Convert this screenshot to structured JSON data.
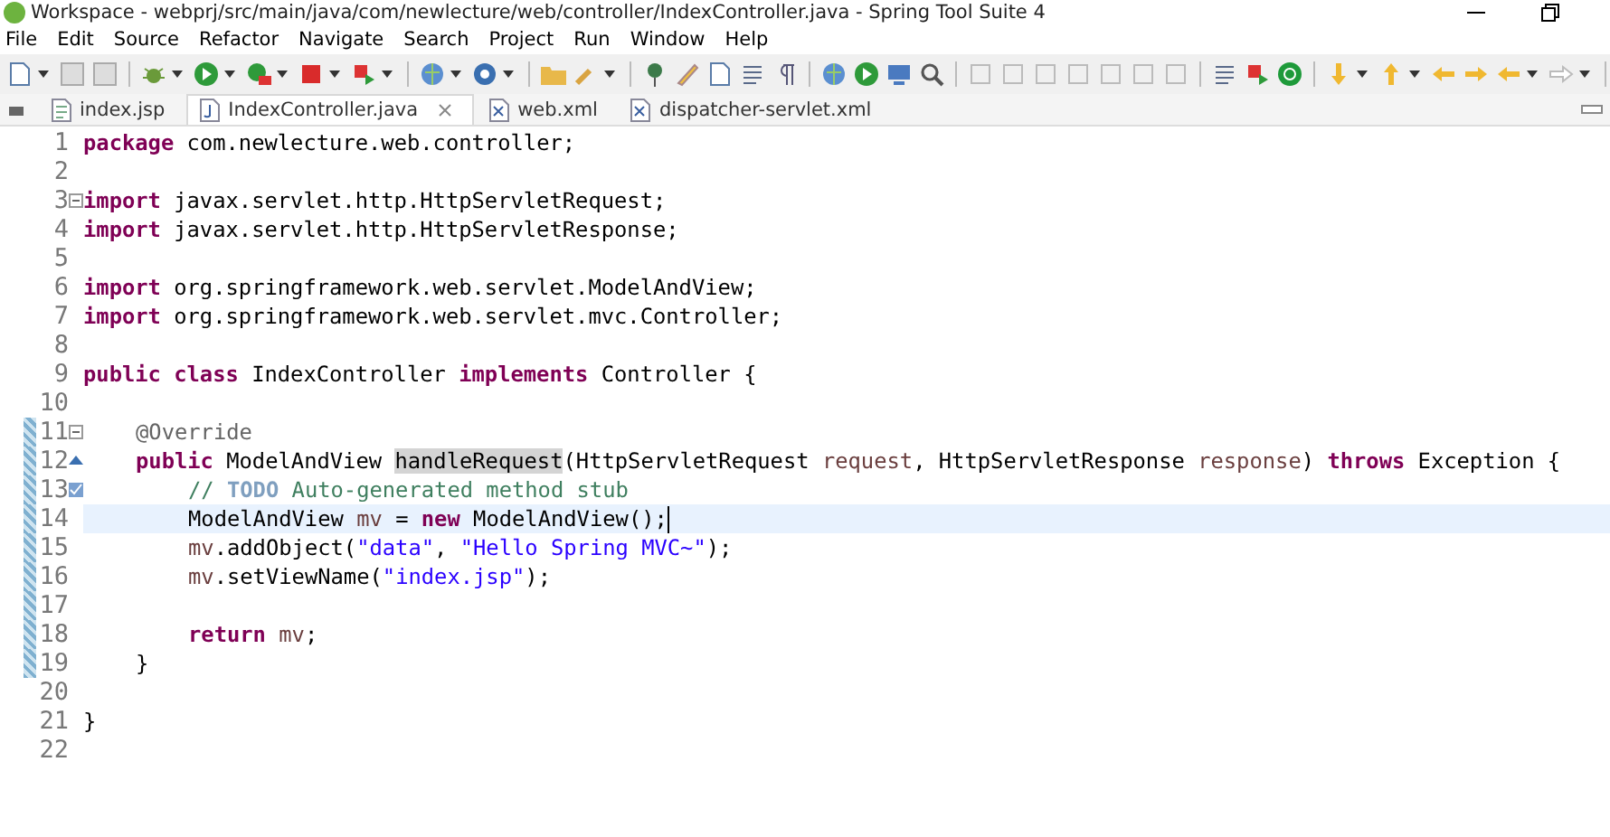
{
  "window": {
    "title": "Workspace - webprj/src/main/java/com/newlecture/web/controller/IndexController.java - Spring Tool Suite 4"
  },
  "menu": [
    "File",
    "Edit",
    "Source",
    "Refactor",
    "Navigate",
    "Search",
    "Project",
    "Run",
    "Window",
    "Help"
  ],
  "tabs": [
    {
      "label": "index.jsp",
      "kind": "jsp",
      "selected": false
    },
    {
      "label": "IndexController.java",
      "kind": "java",
      "selected": true
    },
    {
      "label": "web.xml",
      "kind": "xml",
      "selected": false
    },
    {
      "label": "dispatcher-servlet.xml",
      "kind": "xml",
      "selected": false
    }
  ],
  "editor": {
    "lines": [
      {
        "n": "1",
        "tokens": [
          {
            "t": "package",
            "kind": "kw"
          },
          {
            "t": " com.newlecture.web.controller;",
            "kind": "plain"
          }
        ]
      },
      {
        "n": "2"
      },
      {
        "n": "3",
        "kind": "fold",
        "tokens": [
          {
            "t": "import",
            "kind": "kw"
          },
          {
            "t": " javax.servlet.http.HttpServletRequest;",
            "kind": "plain"
          }
        ]
      },
      {
        "n": "4",
        "tokens": [
          {
            "t": "import",
            "kind": "kw"
          },
          {
            "t": " javax.servlet.http.HttpServletResponse;",
            "kind": "plain"
          }
        ]
      },
      {
        "n": "5"
      },
      {
        "n": "6",
        "tokens": [
          {
            "t": "import",
            "kind": "kw"
          },
          {
            "t": " org.springframework.web.servlet.ModelAndView;",
            "kind": "plain"
          }
        ]
      },
      {
        "n": "7",
        "tokens": [
          {
            "t": "import",
            "kind": "kw"
          },
          {
            "t": " org.springframework.web.servlet.mvc.Controller;",
            "kind": "plain"
          }
        ]
      },
      {
        "n": "8"
      },
      {
        "n": "9",
        "tokens": [
          {
            "t": "public class",
            "kind": "kw"
          },
          {
            "t": " IndexController ",
            "kind": "plain"
          },
          {
            "t": "implements",
            "kind": "kw"
          },
          {
            "t": " Controller {",
            "kind": "plain"
          }
        ]
      },
      {
        "n": "10"
      },
      {
        "n": "11",
        "kind": "fold",
        "changed": true,
        "tokens": [
          {
            "t": "\t@Override",
            "kind": "ann"
          }
        ]
      },
      {
        "n": "12",
        "kind": "override",
        "changed": true,
        "tokens": [
          {
            "t": "\tpublic",
            "kind": "kw"
          },
          {
            "t": " ModelAndView ",
            "kind": "plain"
          },
          {
            "t": "handleRequest",
            "kind": "occurrence"
          },
          {
            "t": "(HttpServletRequest ",
            "kind": "plain"
          },
          {
            "t": "request",
            "kind": "param"
          },
          {
            "t": ", HttpServletResponse ",
            "kind": "plain"
          },
          {
            "t": "response",
            "kind": "param"
          },
          {
            "t": ") ",
            "kind": "plain"
          },
          {
            "t": "throws",
            "kind": "kw"
          },
          {
            "t": " Exception {",
            "kind": "plain"
          }
        ]
      },
      {
        "n": "13",
        "kind": "task",
        "changed": true,
        "tokens": [
          {
            "t": "\t\t// ",
            "kind": "comment"
          },
          {
            "t": "TODO",
            "kind": "todo"
          },
          {
            "t": " Auto-generated method stub",
            "kind": "comment"
          }
        ]
      },
      {
        "n": "14",
        "changed": true,
        "current": true,
        "tokens": [
          {
            "t": "\t\tModelAndView ",
            "kind": "plain"
          },
          {
            "t": "mv",
            "kind": "local"
          },
          {
            "t": " = ",
            "kind": "plain"
          },
          {
            "t": "new",
            "kind": "kw"
          },
          {
            "t": " ModelAndView();",
            "kind": "plain"
          }
        ]
      },
      {
        "n": "15",
        "changed": true,
        "tokens": [
          {
            "t": "\t\tmv",
            "kind": "local"
          },
          {
            "t": ".addObject(",
            "kind": "plain"
          },
          {
            "t": "\"data\"",
            "kind": "str"
          },
          {
            "t": ", ",
            "kind": "plain"
          },
          {
            "t": "\"Hello Spring MVC~\"",
            "kind": "str"
          },
          {
            "t": ");",
            "kind": "plain"
          }
        ]
      },
      {
        "n": "16",
        "changed": true,
        "tokens": [
          {
            "t": "\t\tmv",
            "kind": "local"
          },
          {
            "t": ".setViewName(",
            "kind": "plain"
          },
          {
            "t": "\"index.jsp\"",
            "kind": "str"
          },
          {
            "t": ");",
            "kind": "plain"
          }
        ]
      },
      {
        "n": "17",
        "changed": true
      },
      {
        "n": "18",
        "changed": true,
        "tokens": [
          {
            "t": "\t\treturn ",
            "kind": "kw"
          },
          {
            "t": "mv",
            "kind": "local"
          },
          {
            "t": ";",
            "kind": "plain"
          }
        ]
      },
      {
        "n": "19",
        "changed": true,
        "tokens": [
          {
            "t": "\t}",
            "kind": "plain"
          }
        ]
      },
      {
        "n": "20"
      },
      {
        "n": "21",
        "tokens": [
          {
            "t": "}",
            "kind": "plain"
          }
        ]
      },
      {
        "n": "22"
      }
    ]
  }
}
